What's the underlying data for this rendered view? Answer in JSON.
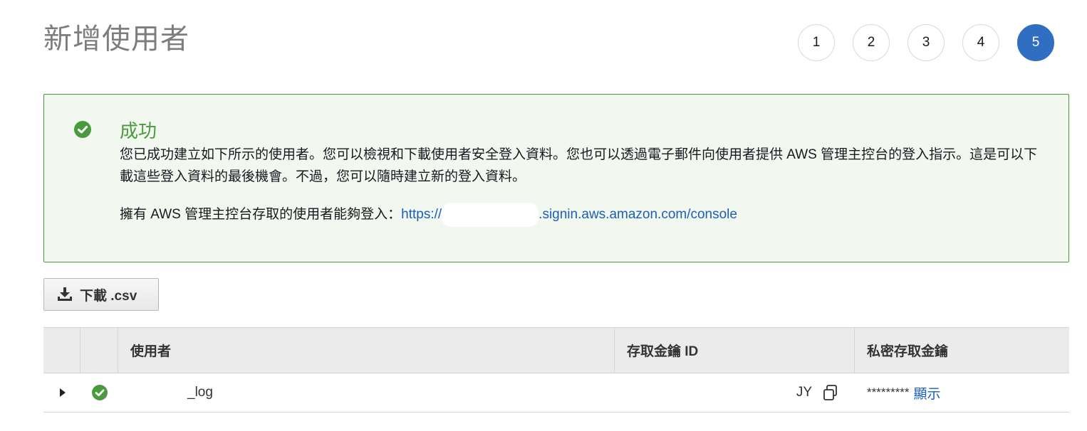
{
  "header": {
    "title": "新增使用者",
    "steps": [
      "1",
      "2",
      "3",
      "4",
      "5"
    ],
    "active_step": "5"
  },
  "alert": {
    "title": "成功",
    "body": "您已成功建立如下所示的使用者。您可以檢視和下載使用者安全登入資料。您也可以透過電子郵件向使用者提供 AWS 管理主控台的登入指示。這是可以下載這些登入資料的最後機會。不過，您可以隨時建立新的登入資料。",
    "login_label": "擁有 AWS 管理主控台存取的使用者能夠登入：",
    "login_url_prefix": "https://",
    "login_url_suffix": ".signin.aws.amazon.com/console",
    "status_color": "#4a9a3e"
  },
  "toolbar": {
    "download_label": "下載 .csv"
  },
  "table": {
    "columns": [
      "",
      "",
      "使用者",
      "存取金鑰 ID",
      "私密存取金鑰"
    ],
    "rows": [
      {
        "user": "_log",
        "access_key_id": "JY",
        "secret_key": "*********",
        "show_label": "顯示"
      }
    ]
  },
  "colors": {
    "accent": "#2f6ec0",
    "success": "#4a9a3e",
    "link": "#1a5fb4"
  }
}
